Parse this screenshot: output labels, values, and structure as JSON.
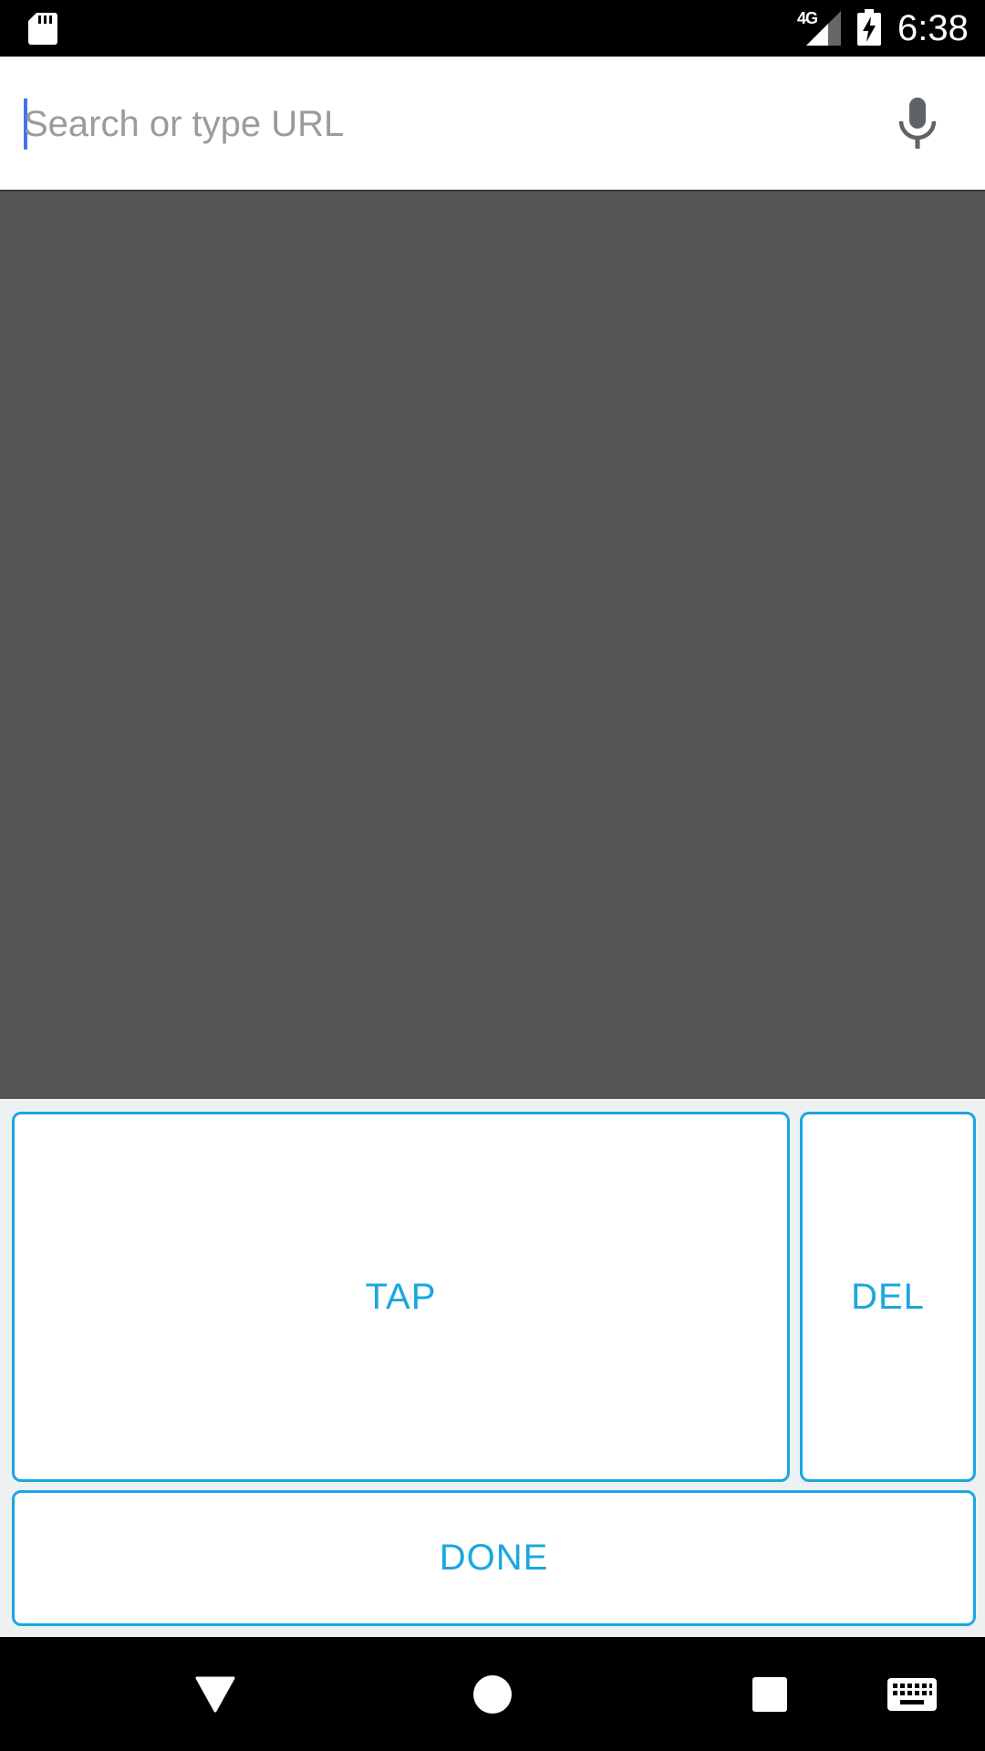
{
  "status_bar": {
    "network_type": "4G",
    "time": "6:38",
    "icons": [
      "sd-card-icon",
      "signal-icon",
      "battery-charging-icon"
    ]
  },
  "address_bar": {
    "placeholder": "Search or type URL",
    "value": "",
    "mic_icon": "microphone-icon"
  },
  "keypad": {
    "tap_label": "TAP",
    "del_label": "DEL",
    "done_label": "DONE",
    "accent_color": "#1aa7e0"
  },
  "nav_bar": {
    "icons": [
      "back-icon",
      "home-icon",
      "recents-icon",
      "keyboard-icon"
    ]
  },
  "colors": {
    "content_background": "#555555",
    "keypad_background": "#eef1f2",
    "cursor": "#3b78e7"
  }
}
